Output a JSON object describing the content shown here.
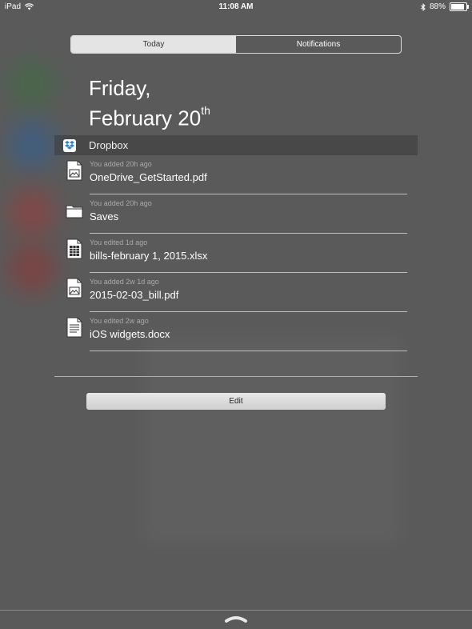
{
  "status_bar": {
    "device": "iPad",
    "time": "11:08 AM",
    "battery": "88%",
    "battery_level": 0.88,
    "icons": [
      "wifi-icon",
      "bluetooth-icon",
      "battery-icon"
    ]
  },
  "segmented": {
    "tabs": [
      {
        "label": "Today",
        "selected": true
      },
      {
        "label": "Notifications",
        "selected": false
      }
    ]
  },
  "date": {
    "weekday": "Friday,",
    "month_day": "February 20",
    "suffix": "th"
  },
  "widget": {
    "title": "Dropbox",
    "icon": "dropbox-icon",
    "items": [
      {
        "meta": "You added 20h ago",
        "name": "OneDrive_GetStarted.pdf",
        "icon": "pdf-file-icon"
      },
      {
        "meta": "You added 20h ago",
        "name": "Saves",
        "icon": "folder-icon"
      },
      {
        "meta": "You edited 1d ago",
        "name": "bills-february 1, 2015.xlsx",
        "icon": "spreadsheet-file-icon"
      },
      {
        "meta": "You added 2w 1d ago",
        "name": "2015-02-03_bill.pdf",
        "icon": "pdf-file-icon"
      },
      {
        "meta": "You edited 2w ago",
        "name": "iOS widgets.docx",
        "icon": "document-file-icon"
      }
    ]
  },
  "edit_label": "Edit"
}
